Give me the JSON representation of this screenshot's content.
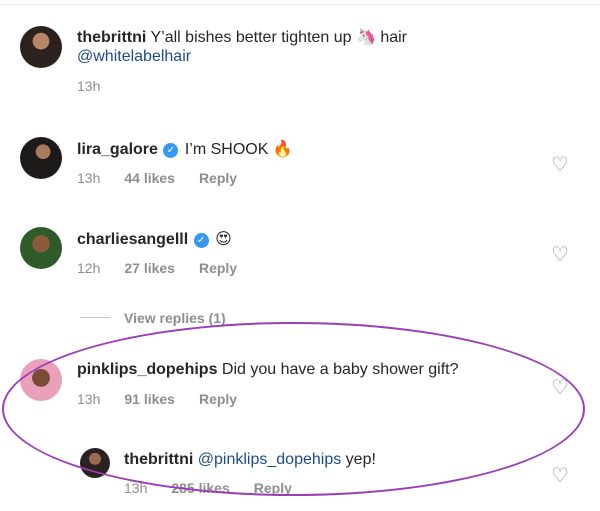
{
  "comments": [
    {
      "username": "thebrittni",
      "text_before": "Y’all bishes better tighten up ",
      "emoji": "🦄",
      "text_after": " hair",
      "mention": "@whitelabelhair",
      "time": "13h"
    },
    {
      "username": "lira_galore",
      "verified": "✓",
      "text": "I’m SHOOK ",
      "emoji": "🔥",
      "time": "13h",
      "likes": "44 likes",
      "reply": "Reply"
    },
    {
      "username": "charliesangelll",
      "verified": "✓",
      "emoji": "😍",
      "time": "12h",
      "likes": "27 likes",
      "reply": "Reply"
    },
    {
      "username": "pinklips_dopehips",
      "text": "Did you have a baby shower gift?",
      "time": "13h",
      "likes": "91 likes",
      "reply": "Reply"
    },
    {
      "username": "thebrittni",
      "mention": "@pinklips_dopehips",
      "text": " yep!",
      "time": "13h",
      "likes": "285 likes",
      "reply": "Reply"
    }
  ],
  "view_replies": "View replies (1)",
  "icons": {
    "like": "heart-outline-icon",
    "verified": "verified-badge-icon"
  },
  "colors": {
    "highlight": "#9b3db6",
    "mention": "#1c4a8a",
    "verified": "#3897f0"
  }
}
